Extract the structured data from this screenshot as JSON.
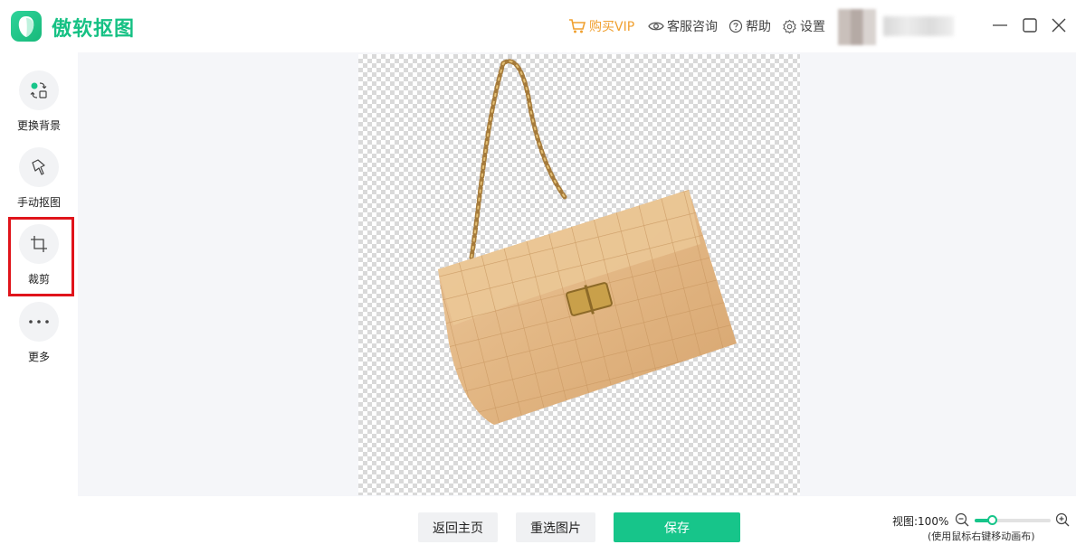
{
  "header": {
    "app_name": "傲软抠图",
    "vip_label": "购买VIP",
    "service_label": "客服咨询",
    "help_label": "帮助",
    "settings_label": "设置"
  },
  "sidebar": {
    "items": [
      {
        "label": "更换背景",
        "icon": "swap-background-icon"
      },
      {
        "label": "手动抠图",
        "icon": "manual-cutout-icon"
      },
      {
        "label": "裁剪",
        "icon": "crop-icon",
        "highlighted": true
      },
      {
        "label": "更多",
        "icon": "more-icon"
      }
    ]
  },
  "footer": {
    "home_button": "返回主页",
    "reselect_button": "重选图片",
    "save_button": "保存",
    "zoom_label": "视图:100%",
    "zoom_hint": "(使用鼠标右键移动画布)",
    "zoom_level": 0.23
  },
  "colors": {
    "brand": "#16c184",
    "vip": "#f0a030",
    "highlight": "#e0141b"
  }
}
